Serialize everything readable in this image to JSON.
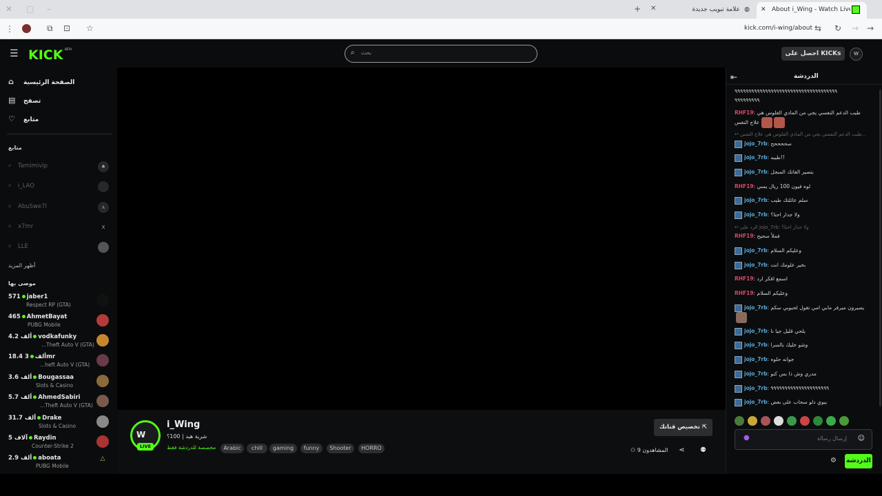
{
  "browser": {
    "tabs": [
      {
        "title": "About i_Wing - Watch Live on"
      },
      {
        "title": "علامة تبويب جديدة"
      }
    ],
    "url": "kick.com/i-wing/about"
  },
  "header": {
    "logo": "KICK",
    "logo_badge": "BETA",
    "search_placeholder": "بحث",
    "get_kicks_label": "احصل على KICKs"
  },
  "sidebar": {
    "nav": [
      {
        "label": "الصفحة الرئيسية",
        "icon": "home-icon"
      },
      {
        "label": "تصفح",
        "icon": "browse-icon"
      },
      {
        "label": "متابع",
        "icon": "heart-icon"
      }
    ],
    "following_title": "متابع",
    "following": [
      {
        "name": "Tamimivip"
      },
      {
        "name": "i_LAO"
      },
      {
        "name": "AbuSwe7l"
      },
      {
        "name": "x7mr"
      },
      {
        "name": "LLE"
      }
    ],
    "show_more": "أظهر المزيد",
    "recommended_title": "موصى بها",
    "recommended": [
      {
        "viewers": "571",
        "name": "jaber1",
        "category": "Respect RP (GTA)"
      },
      {
        "viewers": "465",
        "name": "AhmetBayat",
        "category": "PUBG Mobile"
      },
      {
        "viewers": "4.2 ألف",
        "name": "vodkafunky",
        "category": "...Theft Auto V (GTA)"
      },
      {
        "viewers": "18.4 ألف",
        "name": "3mr",
        "category": "...heft Auto V (GTA)"
      },
      {
        "viewers": "3.6 ألف",
        "name": "Bougassaa",
        "category": "Slots & Casino"
      },
      {
        "viewers": "5.7 ألف",
        "name": "AhmedSabiri",
        "category": "...Theft Auto V (GTA)"
      },
      {
        "viewers": "31.7 ألف",
        "name": "Drake",
        "category": "Slots & Casino"
      },
      {
        "viewers": "5 آلاف",
        "name": "Raydin",
        "category": "Counter-Strike 2"
      },
      {
        "viewers": "2.9 ألف",
        "name": "aboata",
        "category": "PUBG Mobile"
      }
    ]
  },
  "channel": {
    "name": "i_Wing",
    "live_badge": "LIVE",
    "subtitle": "شرية هيد | 100؟",
    "chat_mode": "مخصصة للدردشة فقط",
    "tags": [
      "Arabic",
      "chill",
      "gaming",
      "funny",
      "Shooter",
      "HORRO"
    ],
    "customize_button": "تخصيص قناتك",
    "viewers_label": "المشاهدون",
    "viewers_count": "9"
  },
  "chat": {
    "title": "الدردشة",
    "messages": [
      {
        "user": "",
        "text": "٩٩٩٩٩٩٩٩٩٩٩٩٩٩٩٩٩٩٩٩٩٩٩٩٩٩٩٩٩٩٩٩٩٩٩٩٩"
      },
      {
        "user": "RHF19",
        "text": "طيب الدعم النفسي يجي من المادي الفلوس هي علاج النفس"
      },
      {
        "user": "",
        "text": "طيب الدعم النفسي يجي من المادي الفلوس هي علاج النفس..."
      },
      {
        "user": "jojo_7rb",
        "text": "سححححح"
      },
      {
        "user": "jojo_7rb",
        "text": "طيبه!!"
      },
      {
        "user": "jojo_7rb",
        "text": "بتصير الفاتك المبجل"
      },
      {
        "user": "RHF19",
        "text": "لوه فيون 100 ريال يمني"
      },
      {
        "user": "jojo_7rb",
        "text": "سلم عائلتك طيب"
      },
      {
        "user": "jojo_7rb",
        "text": "ولا جدار احتا؟"
      },
      {
        "user": "",
        "text": "الرد على jojo_7rb: ولا جدار احتا؟"
      },
      {
        "user": "RHF19",
        "text": "فملأ سحيح"
      },
      {
        "user": "jojo_7rb",
        "text": "وعليكم السلام"
      },
      {
        "user": "jojo_7rb",
        "text": "بخير علومك انت"
      },
      {
        "user": "RHF19",
        "text": "اسمع افكر ارد"
      },
      {
        "user": "RHF19",
        "text": "وعليكم السلام"
      },
      {
        "user": "jojo_7rb",
        "text": "اذا يصيرون ميرفر مابي امي تقول لحبوبي سكم"
      },
      {
        "user": "jojo_7rb",
        "text": "يلحي قليل جيا نا"
      },
      {
        "user": "jojo_7rb",
        "text": "وشو خليك بالسرا"
      },
      {
        "user": "jojo_7rb",
        "text": "جوانه حلوه"
      },
      {
        "user": "jojo_7rb",
        "text": "مدري وش ذا بس كنو"
      },
      {
        "user": "jojo_7rb",
        "text": "٩٩٩٩٩٩٩٩٩٩٩٩٩٩٩٩٩٩٩٩٩"
      },
      {
        "user": "jojo_7rb",
        "text": "يبوي دلو سحاب على بعض"
      }
    ],
    "input_placeholder": "إرسال رسالة",
    "send_label": "الدردشة"
  }
}
